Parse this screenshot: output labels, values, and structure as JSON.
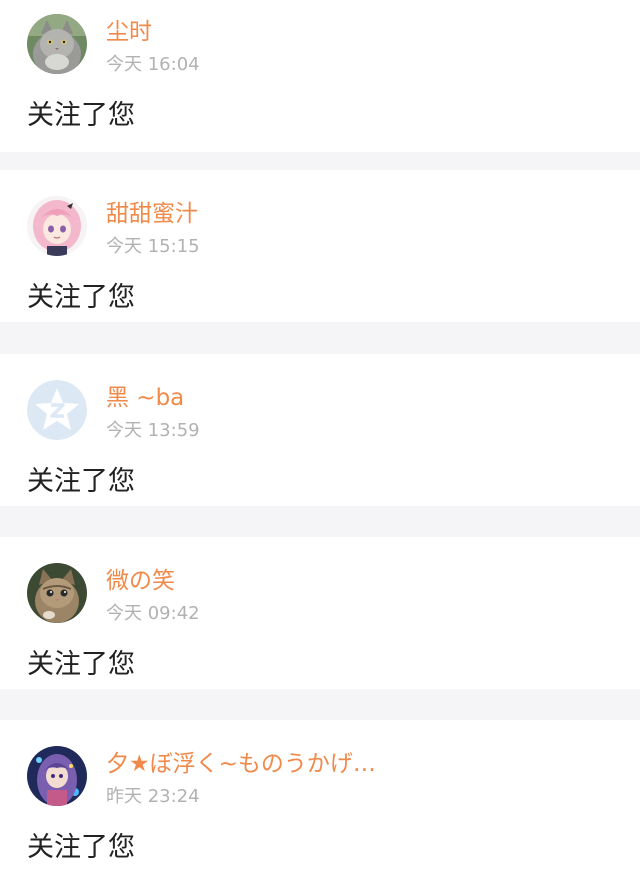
{
  "colors": {
    "name": "#f08a4b",
    "time": "#b2b2b2",
    "message": "#222222",
    "divider": "#f5f5f7"
  },
  "notifications": [
    {
      "name": "尘时",
      "time": "今天 16:04",
      "message": "关注了您",
      "avatar_icon": "gray-cat-avatar"
    },
    {
      "name": "甜甜蜜汁",
      "time": "今天 15:15",
      "message": "关注了您",
      "avatar_icon": "anime-girl-pink-hair-avatar"
    },
    {
      "name": "黑 ~ba",
      "time": "今天 13:59",
      "message": "关注了您",
      "avatar_icon": "qzone-star-default-avatar"
    },
    {
      "name": "微の笑",
      "time": "今天 09:42",
      "message": "关注了您",
      "avatar_icon": "tabby-kitten-avatar"
    },
    {
      "name": "夕★ぼ浮く~ものうかげ…",
      "time": "昨天 23:24",
      "message": "关注了您",
      "avatar_icon": "anime-girl-purple-hair-avatar"
    }
  ]
}
